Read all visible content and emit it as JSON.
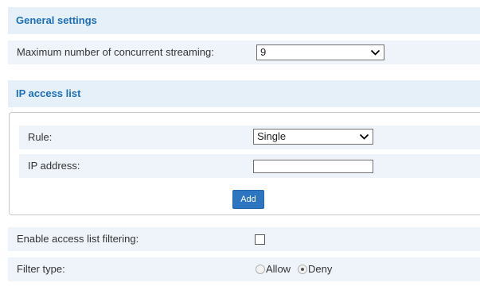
{
  "general": {
    "title": "General settings",
    "max_streaming_label": "Maximum number of concurrent streaming:",
    "max_streaming_value": "9"
  },
  "ip_access": {
    "title": "IP access list",
    "rule_label": "Rule:",
    "rule_value": "Single",
    "ip_label": "IP address:",
    "ip_value": "",
    "add_label": "Add"
  },
  "filtering": {
    "enable_label": "Enable access list filtering:",
    "enable_checked": false,
    "filter_type_label": "Filter type:",
    "options": [
      "Allow",
      "Deny"
    ],
    "selected": "Deny"
  },
  "colors": {
    "accent": "#1c6fb8",
    "section_bg": "#e6f0f9",
    "row_bg": "#eef4fa",
    "button_bg": "#2d75c0"
  }
}
